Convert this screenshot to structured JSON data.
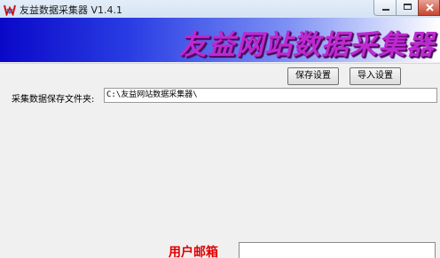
{
  "window": {
    "title": "友益数据采集器 V1.4.1",
    "app_icon": "app-logo-icon"
  },
  "banner": {
    "text": "友益网站数据采集器",
    "color": "#bd2ad0"
  },
  "toolbar": {
    "save_label": "保存设置",
    "import_label": "导入设置"
  },
  "form": {
    "folder_label": "采集数据保存文件夹:",
    "folder_value": "C:\\友益网站数据采集器\\",
    "email_label": "用户邮箱",
    "email_value": ""
  }
}
